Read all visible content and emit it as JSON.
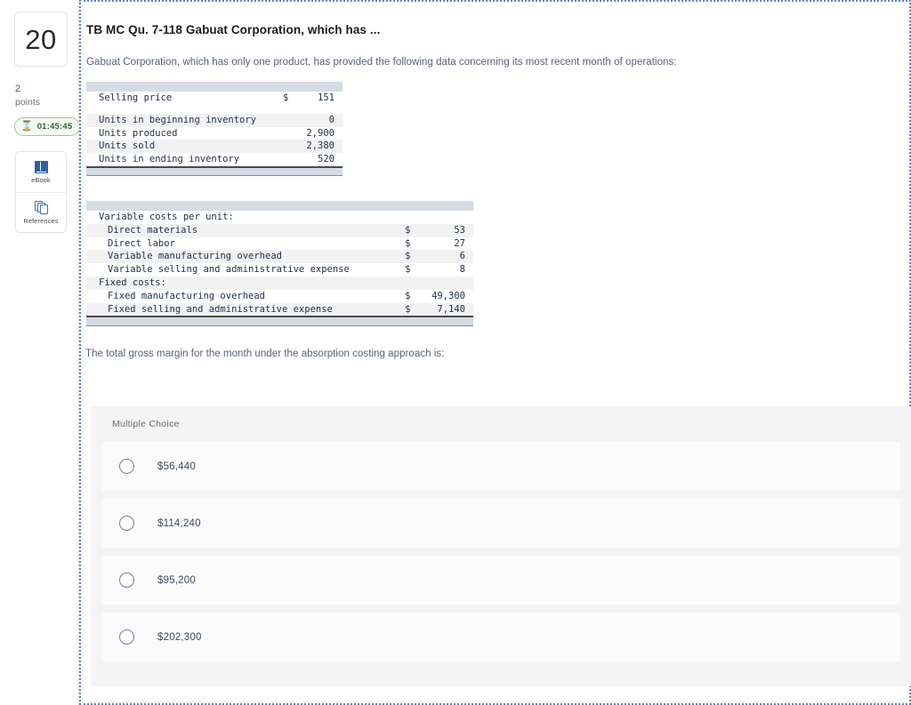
{
  "sidebar": {
    "question_number": "20",
    "points_value": "2",
    "points_label": "points",
    "timer": "01:45:45",
    "timer_icon": "hourglass-icon",
    "tools": [
      {
        "label": "eBook",
        "icon": "book-icon"
      },
      {
        "label": "References",
        "icon": "documents-icon"
      }
    ]
  },
  "question": {
    "title": "TB MC Qu. 7-118 Gabuat Corporation, which has ...",
    "intro": "Gabuat Corporation, which has only one product, has provided the following data concerning its most recent month of operations:",
    "prompt": "The total gross margin for the month under the absorption costing approach is:"
  },
  "table1": {
    "rows": [
      {
        "label": "Selling price",
        "symbol": "$",
        "value": "151"
      },
      {
        "label": "Units in beginning inventory",
        "symbol": "",
        "value": "0"
      },
      {
        "label": "Units produced",
        "symbol": "",
        "value": "2,900"
      },
      {
        "label": "Units sold",
        "symbol": "",
        "value": "2,380"
      },
      {
        "label": "Units in ending inventory",
        "symbol": "",
        "value": "520"
      }
    ]
  },
  "table2": {
    "rows": [
      {
        "label": "Variable costs per unit:",
        "symbol": "",
        "value": ""
      },
      {
        "label": "Direct materials",
        "symbol": "$",
        "value": "53"
      },
      {
        "label": "Direct labor",
        "symbol": "$",
        "value": "27"
      },
      {
        "label": "Variable manufacturing overhead",
        "symbol": "$",
        "value": "6"
      },
      {
        "label": "Variable selling and administrative expense",
        "symbol": "$",
        "value": "8"
      },
      {
        "label": "Fixed costs:",
        "symbol": "",
        "value": ""
      },
      {
        "label": "Fixed manufacturing overhead",
        "symbol": "$",
        "value": "49,300"
      },
      {
        "label": "Fixed selling and administrative expense",
        "symbol": "$",
        "value": "7,140"
      }
    ]
  },
  "multiple_choice": {
    "header": "Multiple Choice",
    "options": [
      {
        "label": "$56,440",
        "selected": false
      },
      {
        "label": "$114,240",
        "selected": false
      },
      {
        "label": "$95,200",
        "selected": false
      },
      {
        "label": "$202,300",
        "selected": false
      }
    ]
  },
  "colors": {
    "table_header_bar": "#d5dbe5",
    "panel_background": "#f4f4f4",
    "option_card": "#fbfbfb",
    "dotted_border": "#5b84c4",
    "timer_green": "#3f8f3f",
    "points_blue": "#3b5a8c"
  }
}
